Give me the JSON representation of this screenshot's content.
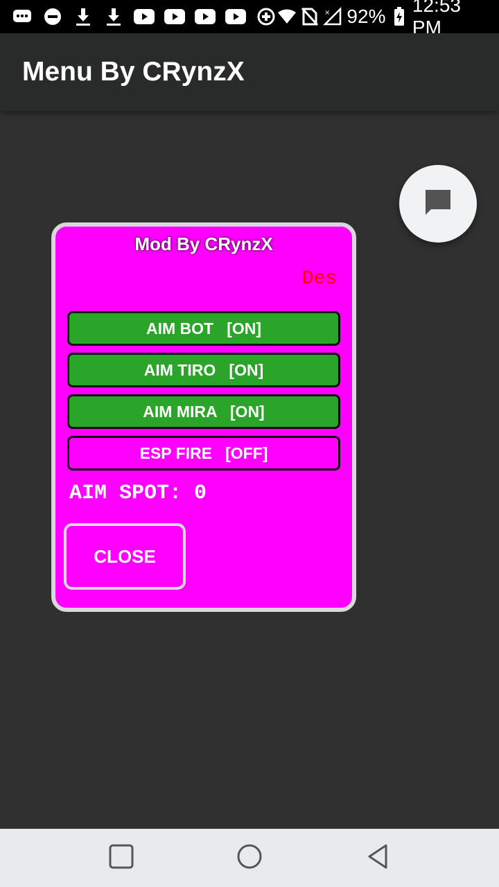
{
  "status_bar": {
    "icons_left": [
      "messages-icon",
      "do-not-disturb-icon",
      "download-icon",
      "download-icon",
      "youtube-icon",
      "youtube-icon",
      "youtube-icon",
      "youtube-icon",
      "data-saver-icon"
    ],
    "battery": "92%",
    "time": "12:53 PM"
  },
  "app_bar": {
    "title": "Menu By CRynzX"
  },
  "fab": {
    "icon": "chat-icon"
  },
  "mod_menu": {
    "title": "Mod By CRynzX",
    "des": "Des",
    "toggles": [
      {
        "label": "AIM BOT   [ON]",
        "state": "on"
      },
      {
        "label": "AIM TIRO   [ON]",
        "state": "on"
      },
      {
        "label": "AIM MIRA   [ON]",
        "state": "on"
      },
      {
        "label": "ESP FIRE   [OFF]",
        "state": "off"
      }
    ],
    "aim_spot": "AIM SPOT: 0",
    "close_label": "CLOSE"
  },
  "colors": {
    "panel_bg": "#ff00ff",
    "toggle_on": "#2aa52a",
    "des_text": "#ff0000",
    "app_bar": "#292a2a",
    "background": "#303030"
  },
  "nav_bar": {
    "buttons": [
      "recents-icon",
      "home-icon",
      "back-icon"
    ]
  }
}
